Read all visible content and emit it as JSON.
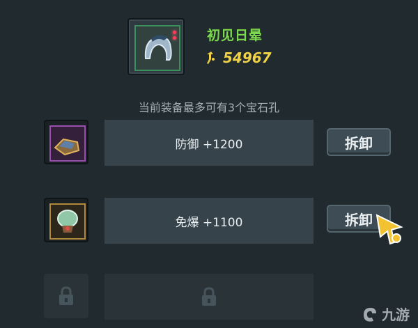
{
  "item": {
    "name": "初见日晕",
    "price": "54967",
    "icon": "helmet-icon",
    "gems_hint_icon": "gem-dots-icon"
  },
  "hint": "当前装备最多可有3个宝石孔",
  "slots": [
    {
      "gem_icon": "purple-gem-icon",
      "stat": "防御 +1200",
      "button": "拆卸"
    },
    {
      "gem_icon": "green-gem-icon",
      "stat": "免爆 +1100",
      "button": "拆卸"
    },
    {
      "locked": true,
      "icon": "lock-icon"
    }
  ],
  "watermark": {
    "text": "九游",
    "icon": "jiuyou-logo-icon"
  },
  "colors": {
    "name": "#7dd94d",
    "price": "#f0d246",
    "purple_frame": "#9a4fb0",
    "gold_frame": "#b38a3c"
  }
}
